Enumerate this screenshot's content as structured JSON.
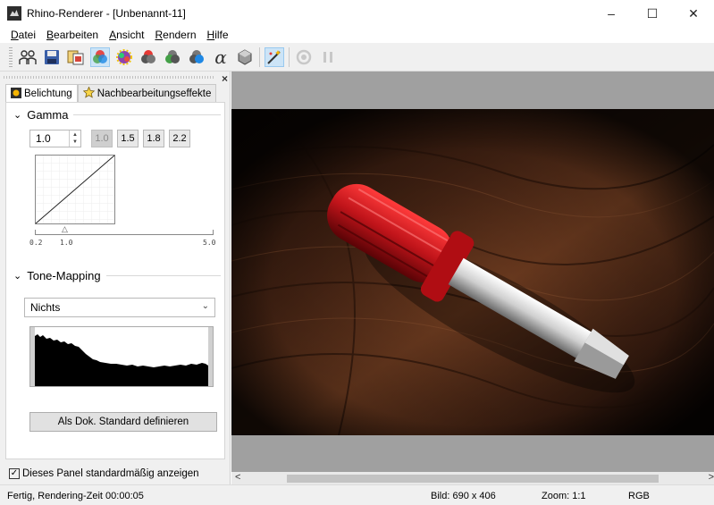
{
  "window": {
    "title": "Rhino-Renderer - [Unbenannt-11]",
    "minimize": "–",
    "maximize": "☐",
    "close": "✕"
  },
  "menu": {
    "items": [
      {
        "first": "D",
        "rest": "atei"
      },
      {
        "first": "B",
        "rest": "earbeiten"
      },
      {
        "first": "A",
        "rest": "nsicht"
      },
      {
        "first": "R",
        "rest": "endern"
      },
      {
        "first": "H",
        "rest": "ilfe"
      }
    ]
  },
  "toolbar": {
    "icons": [
      "people-icon",
      "save-icon",
      "copy-icon",
      "rgb-color-icon",
      "color-noise-icon",
      "red-channel-icon",
      "green-channel-icon",
      "blue-channel-icon",
      "alpha-channel-icon",
      "material-sphere-icon",
      "post-effects-icon",
      "stop-icon",
      "pause-icon"
    ],
    "alpha_glyph": "α"
  },
  "panel": {
    "close_glyph": "×",
    "tabs": [
      {
        "label": "Belichtung",
        "selected": true
      },
      {
        "label": "Nachbearbeitungseffekte",
        "selected": false
      }
    ],
    "gamma": {
      "title": "Gamma",
      "value": "1.0",
      "presets": [
        {
          "label": "1.0",
          "disabled": true
        },
        {
          "label": "1.5",
          "disabled": false
        },
        {
          "label": "1.8",
          "disabled": false
        },
        {
          "label": "2.2",
          "disabled": false
        }
      ],
      "slider_min": "0.2",
      "slider_mid": "1.0",
      "slider_max": "5.0",
      "slider_value": 1.0
    },
    "tone_mapping": {
      "title": "Tone-Mapping",
      "selected": "Nichts"
    },
    "default_button": "Als Dok. Standard definieren",
    "show_panel_checkbox": {
      "label": "Dieses Panel standardmäßig anzeigen",
      "checked": true
    }
  },
  "scrollbar": {
    "left": "<",
    "right": ">"
  },
  "status": {
    "message": "Fertig, Rendering-Zeit 00:00:05",
    "image_size": "Bild: 690 x 406",
    "zoom": "Zoom: 1:1",
    "channel": "RGB"
  },
  "colors": {
    "accent": "#cce4f7",
    "screwdriver_handle": "#c0141a",
    "wood_dark": "#3a1d10"
  }
}
